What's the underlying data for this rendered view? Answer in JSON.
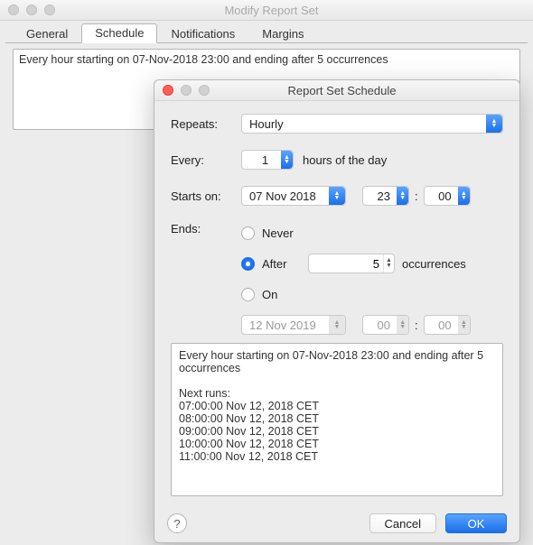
{
  "parent_window": {
    "title": "Modify Report Set",
    "tabs": [
      "General",
      "Schedule",
      "Notifications",
      "Margins"
    ],
    "active_tab_index": 1,
    "summary": "Every hour starting on 07-Nov-2018 23:00 and ending after 5 occurrences"
  },
  "dialog": {
    "title": "Report Set Schedule",
    "labels": {
      "repeats": "Repeats:",
      "every": "Every:",
      "every_suffix": "hours of the day",
      "starts_on": "Starts on:",
      "ends": "Ends:",
      "ends_never": "Never",
      "ends_after": "After",
      "ends_after_suffix": "occurrences",
      "ends_on": "On",
      "colon": ":",
      "help": "?",
      "cancel": "Cancel",
      "ok": "OK"
    },
    "values": {
      "repeats": "Hourly",
      "every": "1",
      "start_date": "07 Nov 2018",
      "start_hour": "23",
      "start_min": "00",
      "ends_selected": "after",
      "ends_after_count": "5",
      "ends_on_date": "12 Nov 2019",
      "ends_on_hour": "00",
      "ends_on_min": "00"
    },
    "preview": "Every hour starting on 07-Nov-2018 23:00 and ending after 5 occurrences\n\nNext runs:\n07:00:00  Nov 12, 2018 CET\n08:00:00  Nov 12, 2018 CET\n09:00:00  Nov 12, 2018 CET\n10:00:00  Nov 12, 2018 CET\n11:00:00  Nov 12, 2018 CET"
  }
}
